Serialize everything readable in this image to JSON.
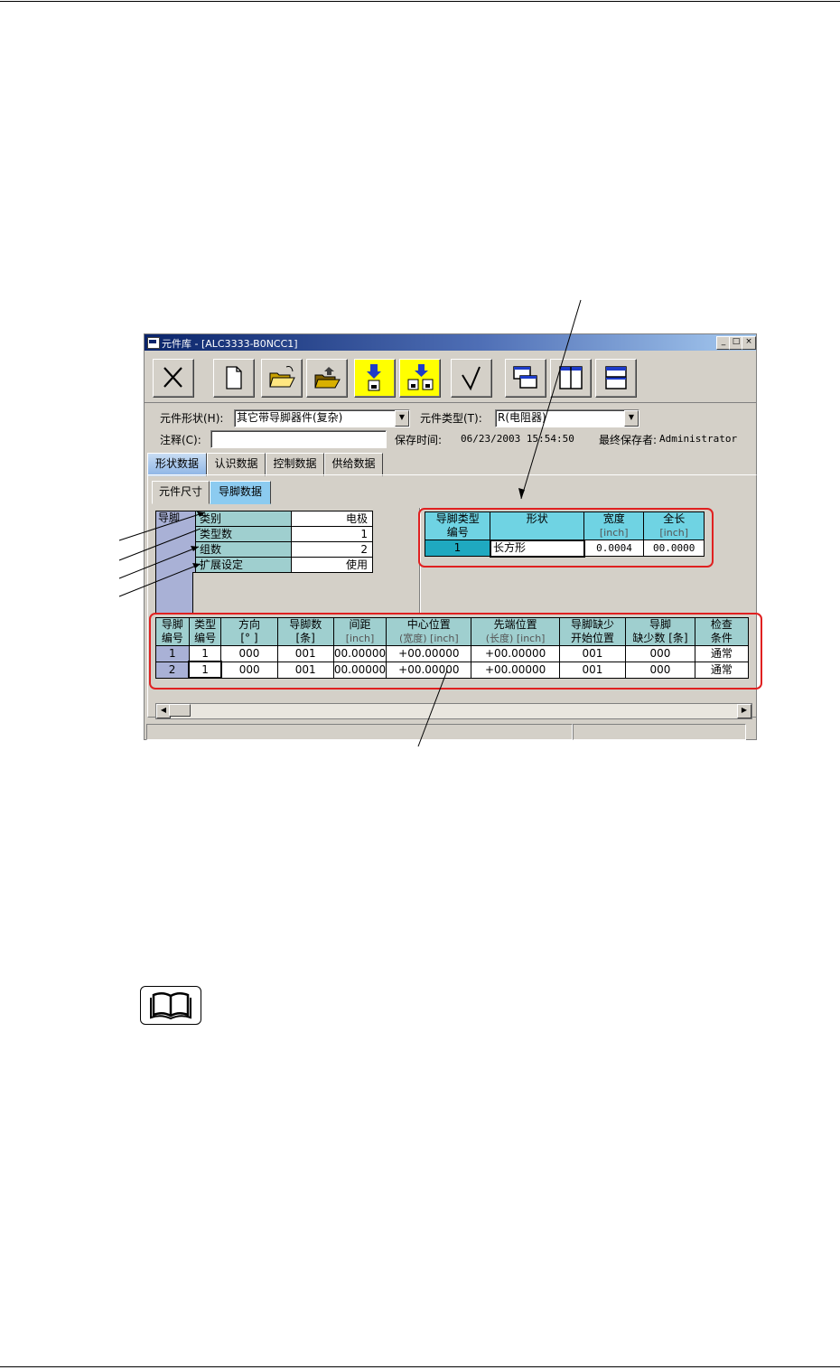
{
  "window": {
    "title": "元件库 - [ALC3333-B0NCC1]",
    "min_label": "_",
    "max_label": "□",
    "close_label": "×"
  },
  "toolbar": {
    "icons": [
      "close-x-icon",
      "new-document-icon",
      "open-folder-icon",
      "open-folder-up-icon",
      "save-icon",
      "save-all-icon",
      "check-icon",
      "cascade-windows-icon",
      "tile-vertical-icon",
      "tile-horizontal-icon"
    ],
    "accent": "#ffff00"
  },
  "form": {
    "shape_label": "元件形状(H):",
    "shape_value": "其它带导脚器件(复杂)",
    "type_label": "元件类型(T):",
    "type_value": "R(电阻器)",
    "note_label": "注释(C):",
    "note_value": "",
    "saved_time_label": "保存时间:",
    "saved_time_value": "06/23/2003 15:54:50",
    "last_saver_label": "最终保存者:",
    "last_saver_value": "Administrator"
  },
  "tabs": [
    "形状数据",
    "认识数据",
    "控制数据",
    "供给数据"
  ],
  "subtabs": [
    "元件尺寸",
    "导脚数据"
  ],
  "lead_settings": {
    "group_label": "导脚",
    "rows": [
      {
        "label": "类别",
        "value": "电极"
      },
      {
        "label": "类型数",
        "value": "1"
      },
      {
        "label": "组数",
        "value": "2"
      },
      {
        "label": "扩展设定",
        "value": "使用"
      }
    ]
  },
  "lead_type_table": {
    "headers": [
      {
        "line1": "导脚类型",
        "line2": "编号"
      },
      {
        "line1": "形状",
        "line2": ""
      },
      {
        "line1": "宽度",
        "line2": "[inch]"
      },
      {
        "line1": "全长",
        "line2": "[inch]"
      }
    ],
    "rows": [
      [
        "1",
        "长方形",
        "0.0004",
        "00.0000"
      ]
    ]
  },
  "lead_group_table": {
    "headers": [
      {
        "line1": "导脚",
        "line2": "编号"
      },
      {
        "line1": "类型",
        "line2": "编号"
      },
      {
        "line1": "方向",
        "line2": "[° ]"
      },
      {
        "line1": "导脚数",
        "line2": "[条]"
      },
      {
        "line1": "间距",
        "line2": "[inch]"
      },
      {
        "line1": "中心位置",
        "line2": "(宽度) [inch]"
      },
      {
        "line1": "先端位置",
        "line2": "(长度) [inch]"
      },
      {
        "line1": "导脚缺少",
        "line2": "开始位置"
      },
      {
        "line1": "导脚",
        "line2": "缺少数 [条]"
      },
      {
        "line1": "检查",
        "line2": "条件"
      }
    ],
    "rows": [
      [
        "1",
        "1",
        "000",
        "001",
        "00.00000",
        "+00.00000",
        "+00.00000",
        "001",
        "000",
        "通常"
      ],
      [
        "2",
        "1",
        "000",
        "001",
        "00.00000",
        "+00.00000",
        "+00.00000",
        "001",
        "000",
        "通常"
      ]
    ]
  },
  "highlight_color": "#e02020",
  "reference_icon": "book-icon"
}
